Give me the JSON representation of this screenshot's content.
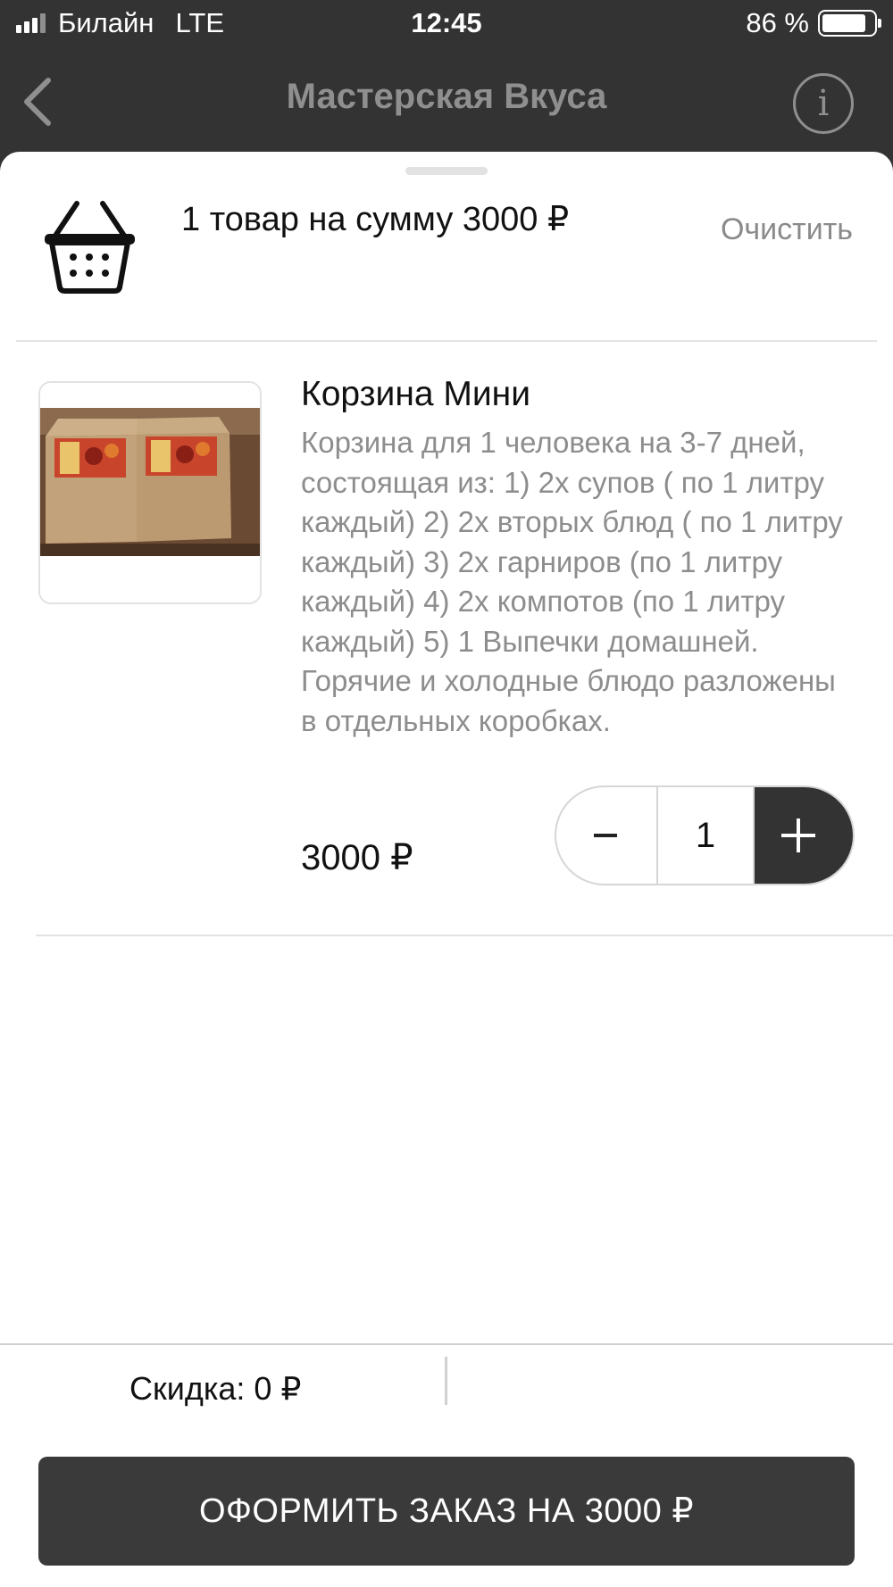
{
  "status_bar": {
    "carrier": "Билайн",
    "network": "LTE",
    "time": "12:45",
    "battery_percent": "86 %",
    "battery_level": 0.86
  },
  "nav": {
    "title": "Мастерская Вкуса",
    "info_glyph": "i",
    "back_icon": "chevron-left-icon",
    "info_icon": "info-circle-icon"
  },
  "cart": {
    "summary": "1 товар на сумму 3000 ₽",
    "clear_label": "Очистить",
    "basket_icon": "basket-icon"
  },
  "item": {
    "title": "Корзина Мини",
    "description": "Корзина для 1 человека на 3-7 дней, состоящая из: 1) 2х супов ( по 1 литру каждый) 2) 2х вторых блюд ( по 1 литру каждый) 3) 2х гарниров (по 1 литру каждый) 4) 2х компотов (по 1 литру каждый) 5) 1 Выпечки домашней. Горячие и холодные блюдо разложены в отдельных коробках.",
    "price": "3000 ₽",
    "quantity": "1"
  },
  "footer": {
    "discount": "Скидка: 0 ₽",
    "checkout_label": "ОФОРМИТЬ ЗАКАЗ НА 3000 ₽"
  },
  "colors": {
    "dark": "#333333",
    "muted_text": "#8d8d8d",
    "divider": "#e4e4e4"
  }
}
